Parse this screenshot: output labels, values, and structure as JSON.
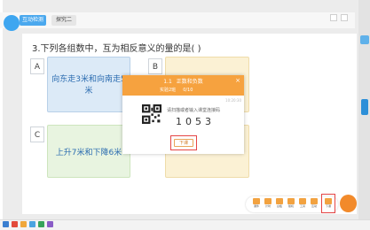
{
  "header": {
    "active_tab": "互动检测",
    "inactive_tab": "探究二"
  },
  "question": {
    "text": "3.下列各组数中，互为相反意义的量的是(   )"
  },
  "options": [
    {
      "letter": "A",
      "lines": [
        "向东走3米和向南走5",
        "米"
      ]
    },
    {
      "letter": "B",
      "lines": []
    },
    {
      "letter": "C",
      "lines": [
        "上升7米和下降6米"
      ]
    }
  ],
  "popup": {
    "section_num": "1.1",
    "section_title": "正数和负数",
    "joined": "实验2班",
    "progress": "0/10",
    "time": "10:20:30",
    "prompt": "请扫描或者输入课堂连接码",
    "code": "1053",
    "button_label": "下课",
    "close_glyph": "×"
  },
  "toolbar": {
    "tools": [
      {
        "label": "课件",
        "icon": "courseware-icon"
      },
      {
        "label": "计时",
        "icon": "timer-icon"
      },
      {
        "label": "白板",
        "icon": "whiteboard-icon"
      },
      {
        "label": "随机",
        "icon": "random-icon"
      },
      {
        "label": "工具",
        "icon": "tools-icon"
      },
      {
        "label": "互动",
        "icon": "interact-icon"
      },
      {
        "label": "下课",
        "icon": "end-class-icon"
      }
    ]
  },
  "colors": {
    "accent": "#f6a23f",
    "blue": "#4aa8ee",
    "highlight": "#e54545"
  }
}
